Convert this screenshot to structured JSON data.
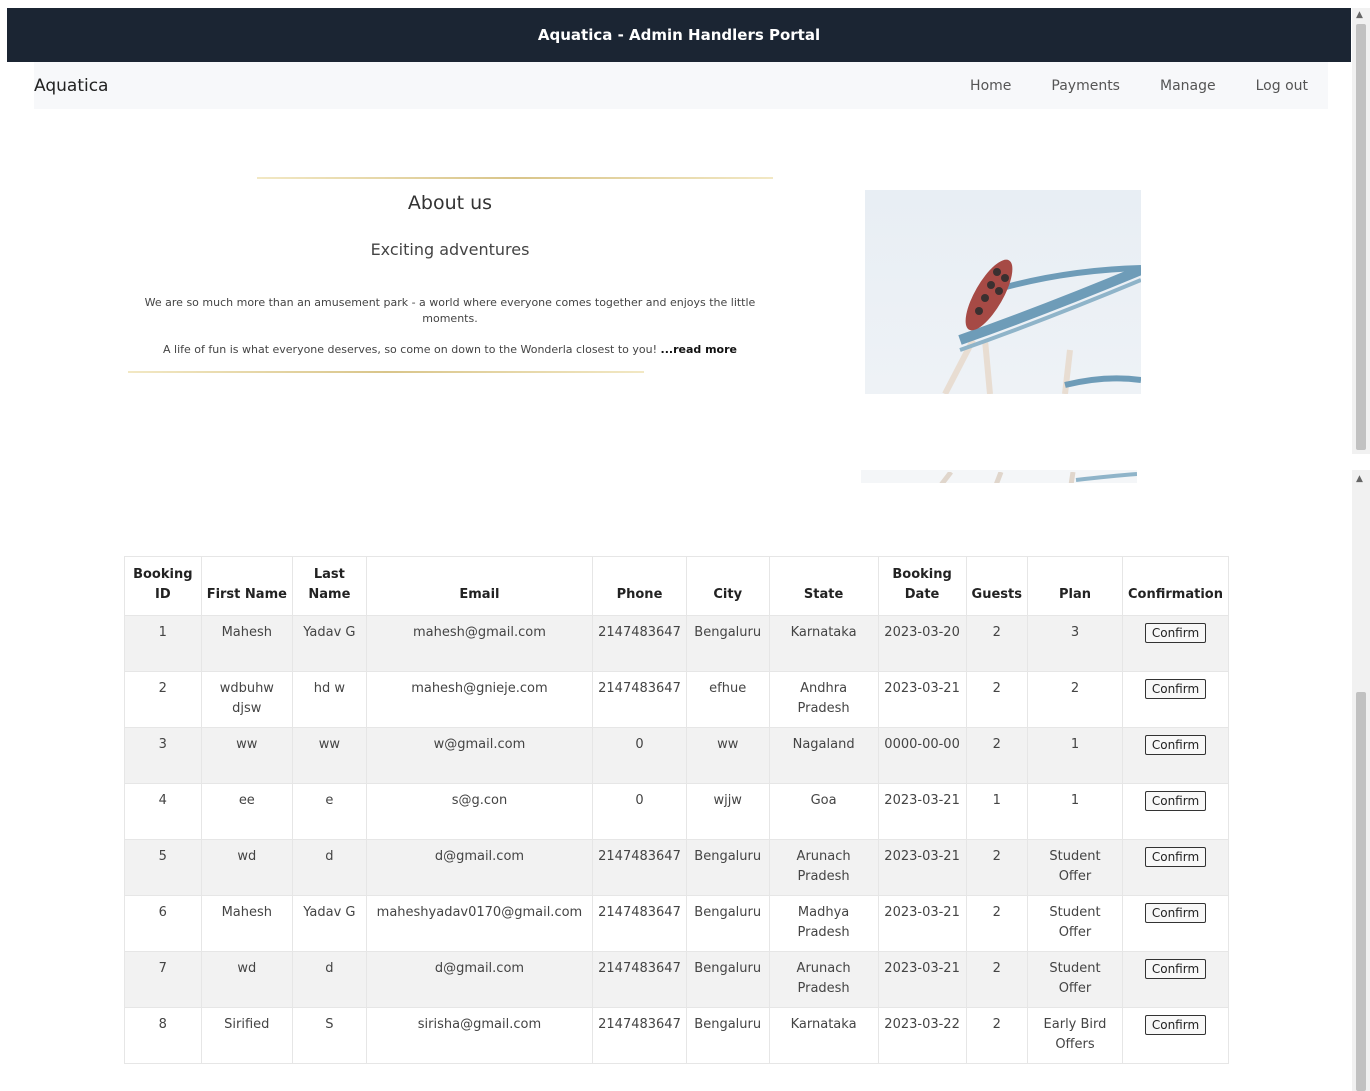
{
  "header": {
    "title": "Aquatica - Admin Handlers Portal"
  },
  "nav": {
    "brand": "Aquatica",
    "links": [
      "Home",
      "Payments",
      "Manage",
      "Log out"
    ]
  },
  "about": {
    "title": "About us",
    "subtitle": "Exciting adventures",
    "paragraph1": "We are so much more than an amusement park - a world where everyone comes together and enjoys the little moments.",
    "paragraph2": "A life of fun is what everyone deserves, so come on down to the Wonderla closest to you!",
    "read_more": "...read more"
  },
  "table": {
    "headers": [
      "Booking ID",
      "First Name",
      "Last Name",
      "Email",
      "Phone",
      "City",
      "State",
      "Booking Date",
      "Guests",
      "Plan",
      "Confirmation"
    ],
    "button_label": "Confirm",
    "rows": [
      [
        "1",
        "Mahesh",
        "Yadav G",
        "mahesh@gmail.com",
        "2147483647",
        "Bengaluru",
        "Karnataka",
        "2023-03-20",
        "2",
        "3"
      ],
      [
        "2",
        "wdbuhw djsw",
        "hd w",
        "mahesh@gnieje.com",
        "2147483647",
        "efhue",
        "Andhra Pradesh",
        "2023-03-21",
        "2",
        "2"
      ],
      [
        "3",
        "ww",
        "ww",
        "w@gmail.com",
        "0",
        "ww",
        "Nagaland",
        "0000-00-00",
        "2",
        "1"
      ],
      [
        "4",
        "ee",
        "e",
        "s@g.con",
        "0",
        "wjjw",
        "Goa",
        "2023-03-21",
        "1",
        "1"
      ],
      [
        "5",
        "wd",
        "d",
        "d@gmail.com",
        "2147483647",
        "Bengaluru",
        "Arunach Pradesh",
        "2023-03-21",
        "2",
        "Student Offer"
      ],
      [
        "6",
        "Mahesh",
        "Yadav G",
        "maheshyadav0170@gmail.com",
        "2147483647",
        "Bengaluru",
        "Madhya Pradesh",
        "2023-03-21",
        "2",
        "Student Offer"
      ],
      [
        "7",
        "wd",
        "d",
        "d@gmail.com",
        "2147483647",
        "Bengaluru",
        "Arunach Pradesh",
        "2023-03-21",
        "2",
        "Student Offer"
      ],
      [
        "8",
        "Sirified",
        "S",
        "sirisha@gmail.com",
        "2147483647",
        "Bengaluru",
        "Karnataka",
        "2023-03-22",
        "2",
        "Early Bird Offers"
      ]
    ]
  },
  "colors": {
    "header_bg": "#1b2533",
    "gold_line": "#d9c58a"
  },
  "icons": [
    "roller-coaster-image",
    "scroll-up-arrow-icon"
  ]
}
